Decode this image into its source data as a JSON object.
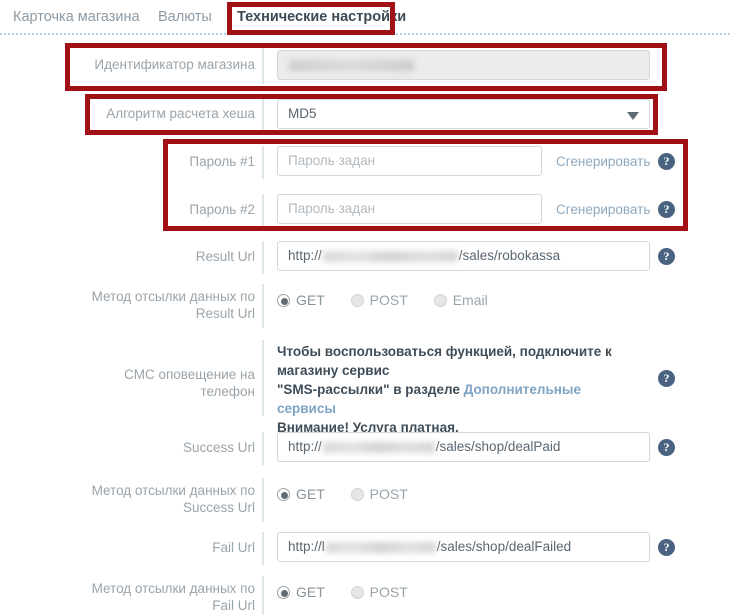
{
  "tabs": [
    {
      "label": "Карточка магазина",
      "active": false
    },
    {
      "label": "Валюты",
      "active": false
    },
    {
      "label": "Технические настройки",
      "active": true
    }
  ],
  "form": {
    "shop_id": {
      "label": "Идентификатор магазина",
      "value": "",
      "masked": true,
      "disabled": true
    },
    "hash_algorithm": {
      "label": "Алгоритм расчета хеша",
      "value": "MD5",
      "options": [
        "MD5"
      ]
    },
    "password1": {
      "label": "Пароль #1",
      "placeholder": "Пароль задан",
      "value": "",
      "generate_label": "Сгенерировать",
      "help": "?"
    },
    "password2": {
      "label": "Пароль #2",
      "placeholder": "Пароль задан",
      "value": "",
      "generate_label": "Сгенерировать",
      "help": "?"
    },
    "result_url": {
      "label": "Result Url",
      "prefix": "http://",
      "suffix": "/sales/robokassa",
      "help": "?"
    },
    "result_method": {
      "label_line1": "Метод отсылки данных по",
      "label_line2": "Result Url",
      "options": [
        "GET",
        "POST",
        "Email"
      ],
      "selected": "GET"
    },
    "sms": {
      "label_line1": "СМС оповещение на",
      "label_line2": "телефон",
      "text_line1": "Чтобы воспользоваться функцией, подключите к",
      "text_line2": "магазину сервис",
      "text_line3_a": "\"SMS-рассылки\" в разделе ",
      "text_line3_link": "Дополнительные сервисы",
      "text_line4": "Внимание! Услуга платная.",
      "help": "?"
    },
    "success_url": {
      "label": "Success Url",
      "prefix": "http://",
      "suffix": "/sales/shop/dealPaid",
      "help": "?"
    },
    "success_method": {
      "label_line1": "Метод отсылки данных по",
      "label_line2": "Success Url",
      "options": [
        "GET",
        "POST"
      ],
      "selected": "GET"
    },
    "fail_url": {
      "label": "Fail Url",
      "prefix": "http://l",
      "suffix": "/sales/shop/dealFailed",
      "help": "?"
    },
    "fail_method": {
      "label_line1": "Метод отсылки данных по",
      "label_line2": "Fail Url",
      "options": [
        "GET",
        "POST"
      ],
      "selected": "GET"
    }
  },
  "annotations": {
    "color": "#a01015",
    "boxes": [
      "tab-highlight",
      "shop-id-highlight",
      "hash-algorithm-highlight",
      "passwords-highlight"
    ]
  }
}
